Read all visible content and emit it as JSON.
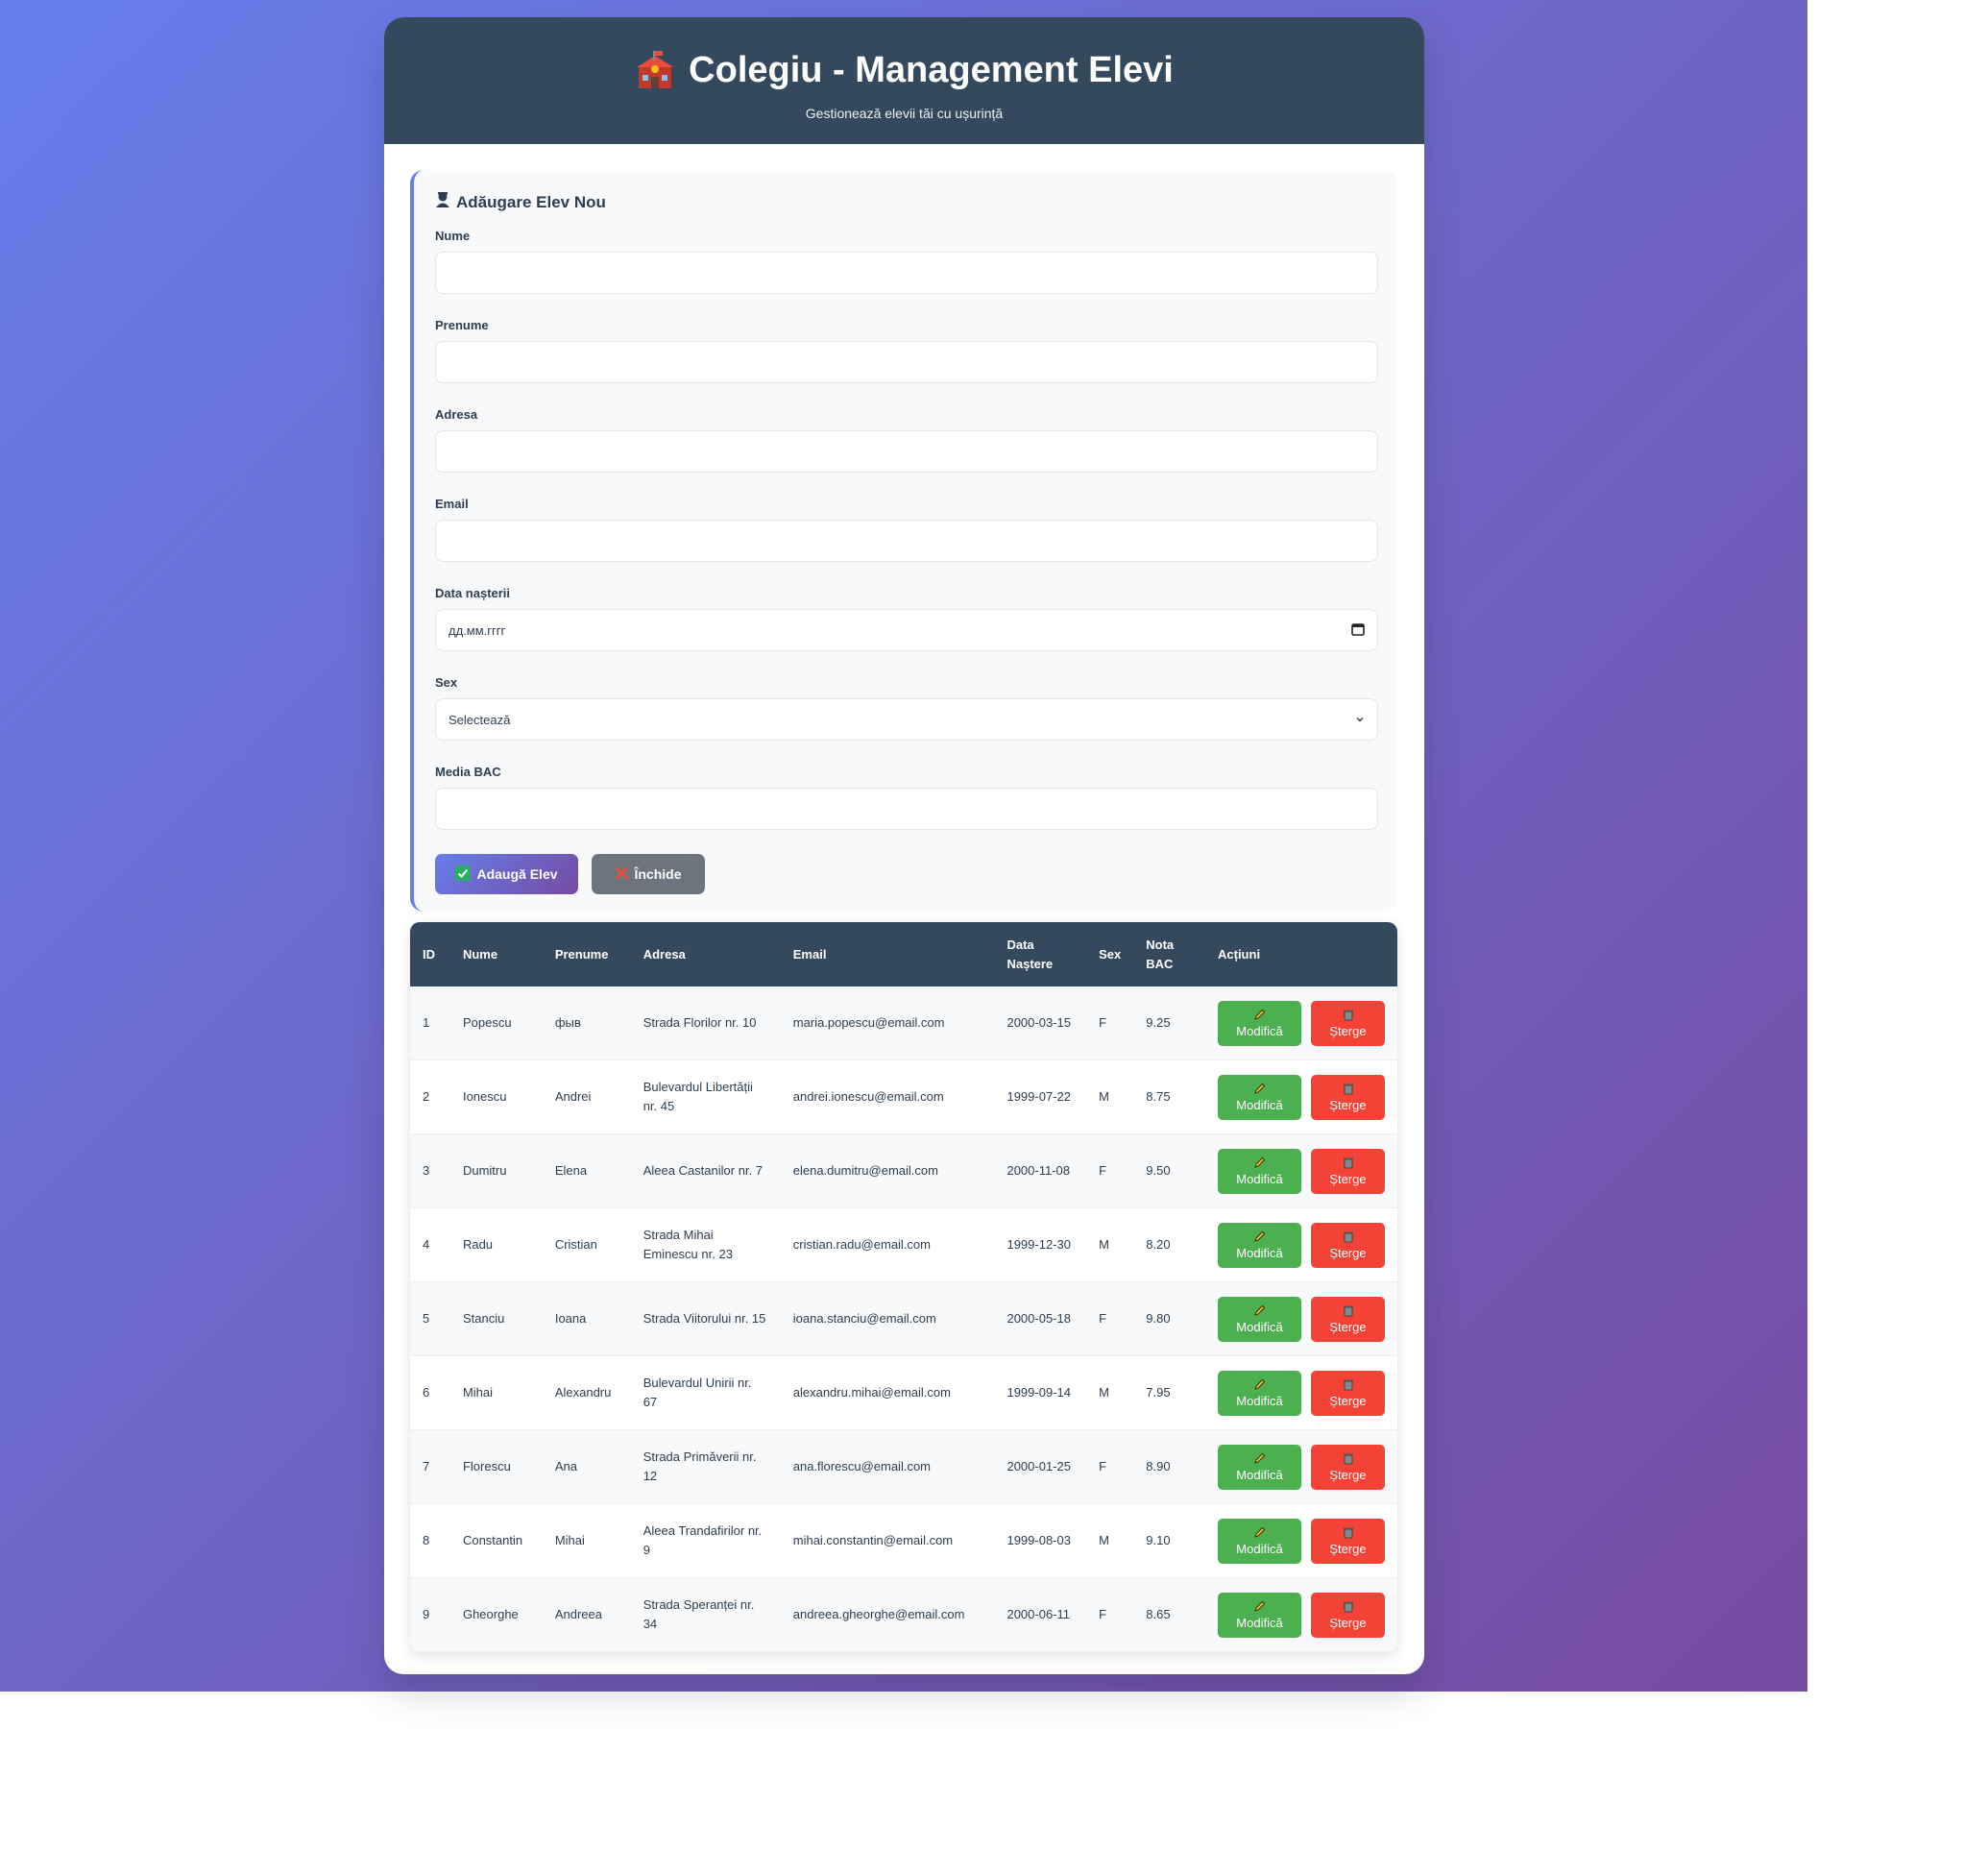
{
  "colors": {
    "gradient_start": "#667eea",
    "gradient_end": "#764ba2",
    "header_bg": "#34495e",
    "edit_green": "#4caf50",
    "delete_red": "#f44336",
    "close_gray": "#6c757d"
  },
  "header": {
    "title": "Colegiu - Management Elevi",
    "subtitle": "Gestionează elevii tăi cu ușurință",
    "icon": "school-icon"
  },
  "form": {
    "title": "Adăugare Elev Nou",
    "title_icon": "student-icon",
    "fields": {
      "nume": {
        "label": "Nume",
        "value": ""
      },
      "prenume": {
        "label": "Prenume",
        "value": ""
      },
      "adresa": {
        "label": "Adresa",
        "value": ""
      },
      "email": {
        "label": "Email",
        "value": ""
      },
      "data_nasterii": {
        "label": "Data nașterii",
        "placeholder": "дд.мм.гггг",
        "icon": "calendar-icon"
      },
      "sex": {
        "label": "Sex",
        "selected": "Selectează",
        "icon": "chevron-down-icon"
      },
      "media_bac": {
        "label": "Media BAC",
        "value": ""
      }
    },
    "add_button": {
      "label": "Adaugă Elev",
      "icon": "check-icon"
    },
    "close_button": {
      "label": "Închide",
      "icon": "cross-icon"
    }
  },
  "table": {
    "headers": [
      "ID",
      "Nume",
      "Prenume",
      "Adresa",
      "Email",
      "Data Naștere",
      "Sex",
      "Nota BAC",
      "Acțiuni"
    ],
    "edit_label": "Modifică",
    "delete_label": "Șterge",
    "rows": [
      [
        "1",
        "Popescu",
        "фыв",
        "Strada Florilor nr. 10",
        "maria.popescu@email.com",
        "2000-03-15",
        "F",
        "9.25"
      ],
      [
        "2",
        "Ionescu",
        "Andrei",
        "Bulevardul Libertății nr. 45",
        "andrei.ionescu@email.com",
        "1999-07-22",
        "M",
        "8.75"
      ],
      [
        "3",
        "Dumitru",
        "Elena",
        "Aleea Castanilor nr. 7",
        "elena.dumitru@email.com",
        "2000-11-08",
        "F",
        "9.50"
      ],
      [
        "4",
        "Radu",
        "Cristian",
        "Strada Mihai Eminescu nr. 23",
        "cristian.radu@email.com",
        "1999-12-30",
        "M",
        "8.20"
      ],
      [
        "5",
        "Stanciu",
        "Ioana",
        "Strada Viitorului nr. 15",
        "ioana.stanciu@email.com",
        "2000-05-18",
        "F",
        "9.80"
      ],
      [
        "6",
        "Mihai",
        "Alexandru",
        "Bulevardul Unirii nr. 67",
        "alexandru.mihai@email.com",
        "1999-09-14",
        "M",
        "7.95"
      ],
      [
        "7",
        "Florescu",
        "Ana",
        "Strada Primăverii nr. 12",
        "ana.florescu@email.com",
        "2000-01-25",
        "F",
        "8.90"
      ],
      [
        "8",
        "Constantin",
        "Mihai",
        "Aleea Trandafirilor nr. 9",
        "mihai.constantin@email.com",
        "1999-08-03",
        "M",
        "9.10"
      ],
      [
        "9",
        "Gheorghe",
        "Andreea",
        "Strada Speranței nr. 34",
        "andreea.gheorghe@email.com",
        "2000-06-11",
        "F",
        "8.65"
      ]
    ]
  }
}
